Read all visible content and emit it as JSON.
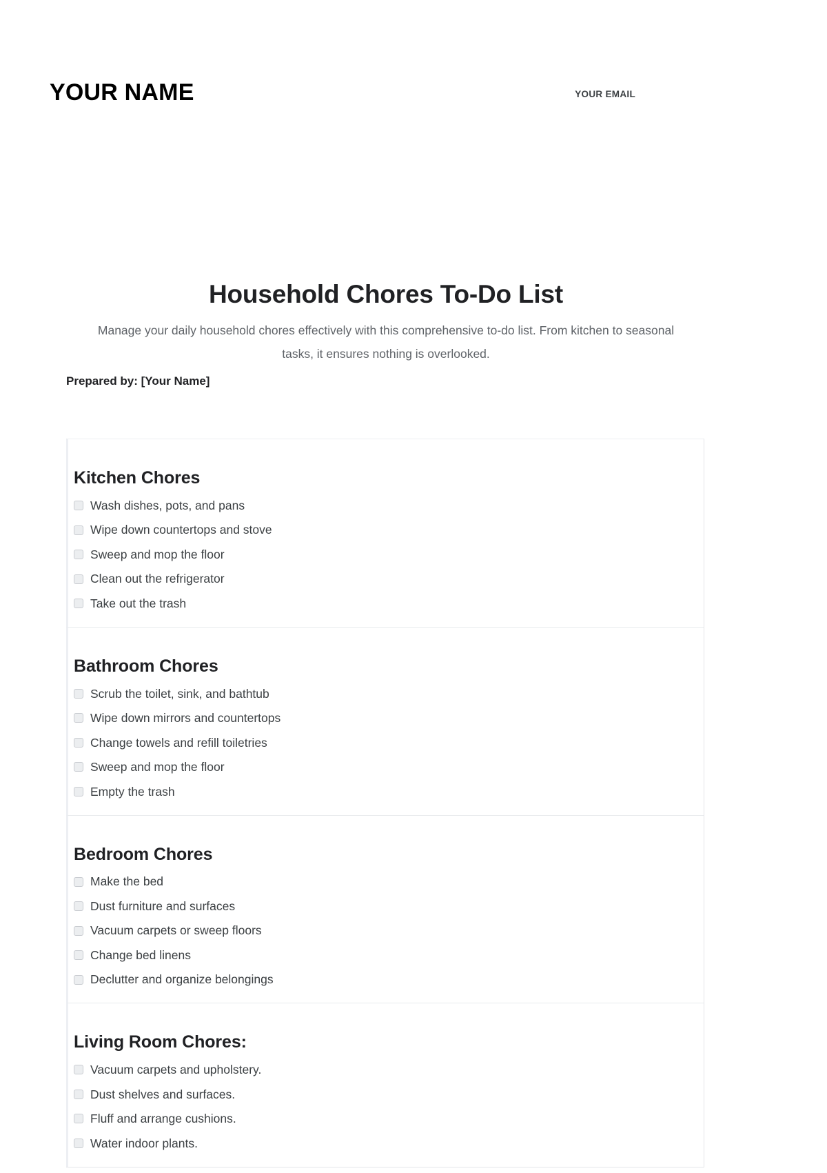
{
  "letterhead": {
    "name": "YOUR NAME",
    "email": "YOUR EMAIL"
  },
  "document": {
    "title": "Household Chores To-Do List",
    "subtitle": "Manage your daily household chores effectively with this comprehensive to-do list. From kitchen to seasonal tasks, it ensures nothing is overlooked.",
    "prepared_by": "Prepared by: [Your Name]"
  },
  "colors": {
    "text_primary": "#202124",
    "text_secondary": "#5f6368",
    "checkbox_fill": "#eceef0",
    "checkbox_border": "#c8cbd0",
    "card_border": "#e3e5e9",
    "divider": "#e8eaed"
  },
  "checklist": {
    "sections": [
      {
        "title": "Kitchen Chores",
        "items": [
          {
            "label": "Wash dishes, pots, and pans",
            "checked": false
          },
          {
            "label": "Wipe down countertops and stove",
            "checked": false
          },
          {
            "label": "Sweep and mop the floor",
            "checked": false
          },
          {
            "label": "Clean out the refrigerator",
            "checked": false
          },
          {
            "label": "Take out the trash",
            "checked": false
          }
        ]
      },
      {
        "title": "Bathroom Chores",
        "items": [
          {
            "label": "Scrub the toilet, sink, and bathtub",
            "checked": false
          },
          {
            "label": "Wipe down mirrors and countertops",
            "checked": false
          },
          {
            "label": "Change towels and refill toiletries",
            "checked": false
          },
          {
            "label": "Sweep and mop the floor",
            "checked": false
          },
          {
            "label": "Empty the trash",
            "checked": false
          }
        ]
      },
      {
        "title": "Bedroom Chores",
        "items": [
          {
            "label": "Make the bed",
            "checked": false
          },
          {
            "label": "Dust furniture and surfaces",
            "checked": false
          },
          {
            "label": "Vacuum carpets or sweep floors",
            "checked": false
          },
          {
            "label": "Change bed linens",
            "checked": false
          },
          {
            "label": "Declutter and organize belongings",
            "checked": false
          }
        ]
      },
      {
        "title": "Living Room Chores:",
        "items": [
          {
            "label": "Vacuum carpets and upholstery.",
            "checked": false
          },
          {
            "label": "Dust shelves and surfaces.",
            "checked": false
          },
          {
            "label": "Fluff and arrange cushions.",
            "checked": false
          },
          {
            "label": "Water indoor plants.",
            "checked": false
          }
        ]
      }
    ]
  }
}
